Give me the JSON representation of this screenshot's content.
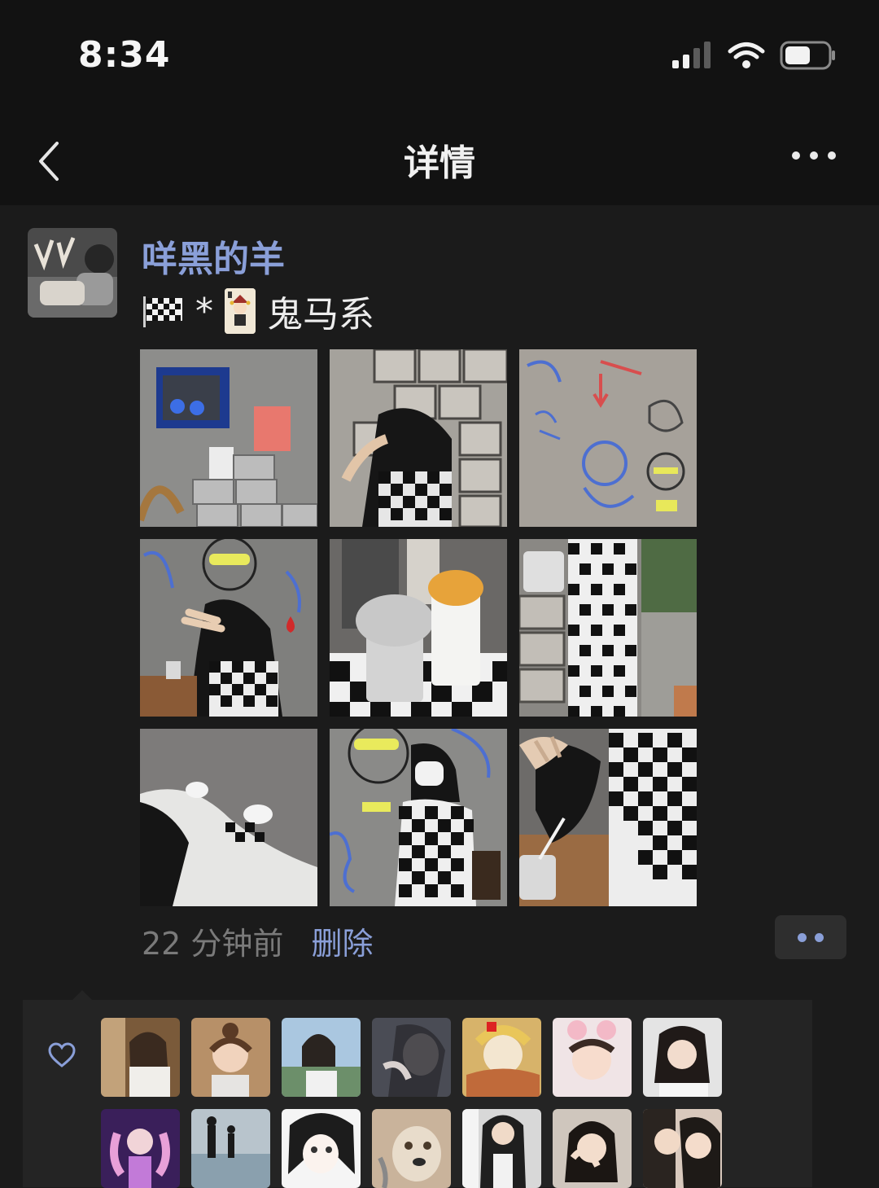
{
  "status": {
    "time": "8:34"
  },
  "nav": {
    "title": "详情"
  },
  "post": {
    "username": "咩黑的羊",
    "text_separator": "*",
    "text_suffix": "鬼马系",
    "timestamp": "22 分钟前",
    "delete_label": "删除",
    "photo_count": 9
  },
  "likes": {
    "visible_avatar_count": 14
  },
  "colors": {
    "link": "#8a9fd8",
    "background": "#1b1b1b",
    "bar": "#121212",
    "panel": "#242424"
  },
  "icons": [
    "chevron-left-icon",
    "more-icon",
    "heart-icon",
    "signal-icon",
    "wifi-icon",
    "battery-icon",
    "checkered-flag-icon",
    "joker-card-icon"
  ]
}
